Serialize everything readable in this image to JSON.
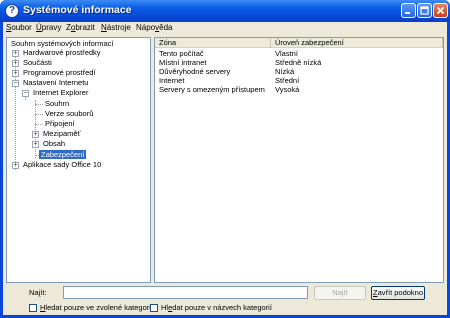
{
  "window": {
    "title": "Systémové informace"
  },
  "menu": [
    {
      "pre": "",
      "u": "S",
      "post": "oubor"
    },
    {
      "pre": "",
      "u": "Ú",
      "post": "pravy"
    },
    {
      "pre": "Z",
      "u": "o",
      "post": "brazit"
    },
    {
      "pre": "",
      "u": "N",
      "post": "ástroje"
    },
    {
      "pre": "Nápo",
      "u": "v",
      "post": "ěda"
    }
  ],
  "tree": {
    "root": "Souhrn systémových informací",
    "items": {
      "hardware": "Hardwarové prostředky",
      "components": "Součásti",
      "software": "Programové prostředí",
      "internet_settings": "Nastavení Internetu",
      "ie": "Internet Explorer",
      "summary": "Souhrn",
      "file_versions": "Verze souborů",
      "connection": "Připojení",
      "cache": "Mezipaměť",
      "content": "Obsah",
      "security": "Zabezpečení",
      "office": "Aplikace sady Office 10"
    }
  },
  "list": {
    "columns": [
      "Zóna",
      "Úroveň zabezpečení"
    ],
    "rows": [
      [
        "Tento počítač",
        "Vlastní"
      ],
      [
        "Místní intranet",
        "Středně nízká"
      ],
      [
        "Důvěryhodné servery",
        "Nízká"
      ],
      [
        "Internet",
        "Střední"
      ],
      [
        "Servery s omezeným přístupem",
        "Vysoká"
      ]
    ]
  },
  "search": {
    "label_pre": "Na",
    "label_u": "j",
    "label_post": "ít:",
    "value": "",
    "find_button": "Najít",
    "close_button_pre": "",
    "close_button_u": "Z",
    "close_button_post": "avřít podokno",
    "check_category_pre": "",
    "check_category_u": "H",
    "check_category_post": "ledat pouze ve zvolené kategorii",
    "check_names_pre": "Hl",
    "check_names_u": "e",
    "check_names_post": "dat pouze v názvech kategorií"
  }
}
